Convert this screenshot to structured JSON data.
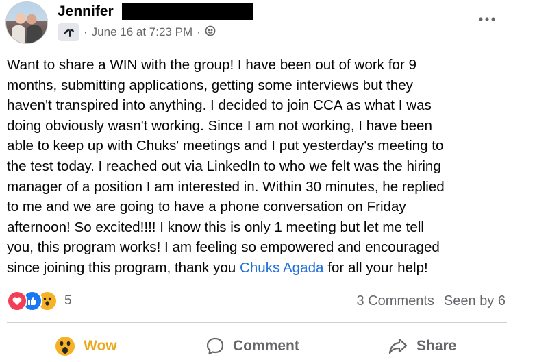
{
  "post": {
    "author_name": "Jennifer",
    "timestamp": "June 16 at 7:23 PM",
    "separator": "·",
    "separator2": "·",
    "audience_icon": "globe-icon",
    "group_icon": "group-badge-icon",
    "more_icon": "more-options-icon",
    "body_lines": [
      "Want to share a WIN with the group! I have been out of work for 9",
      "months, submitting applications, getting some interviews but they",
      "haven't transpired into anything. I decided to join CCA as what I was",
      "doing obviously wasn't working. Since I am not working, I have been",
      "able to keep up with Chuks' meetings and I put yesterday's meeting to",
      "the test today. I reached out via LinkedIn to who we felt was the hiring",
      "manager of a position I am interested in. Within 30 minutes, he replied",
      "to me and we are going to have a phone conversation on Friday",
      "afternoon! So excited!!!! I know this is only 1 meeting but let me tell",
      "you, this program works! I am feeling so empowered and encouraged"
    ],
    "last_line_prefix": "since joining this program, thank you ",
    "mention": "Chuks Agada",
    "last_line_suffix": " for all your help!"
  },
  "engagement": {
    "reaction_icons": [
      "love-reaction-icon",
      "like-reaction-icon",
      "wow-reaction-icon"
    ],
    "reaction_count": "5",
    "comments": "3 Comments",
    "seen_by": "Seen by 6"
  },
  "actions": {
    "wow_label": "Wow",
    "comment_label": "Comment",
    "share_label": "Share"
  },
  "colors": {
    "text": "#050505",
    "secondary": "#65676b",
    "mention": "#216fdb",
    "wow_active": "#e9a91c",
    "love": "#f33e58",
    "like": "#1877f2"
  }
}
